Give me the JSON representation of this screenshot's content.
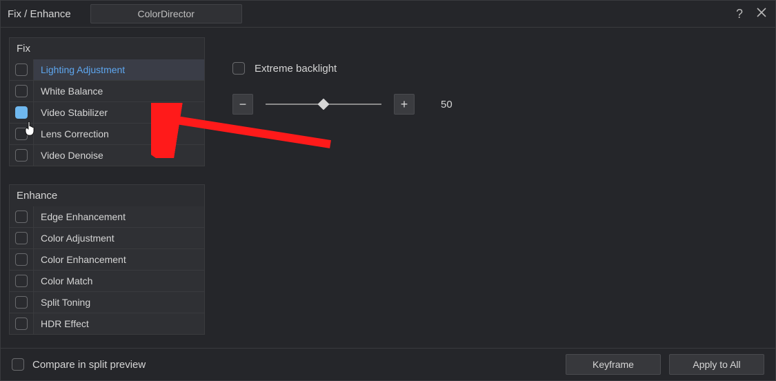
{
  "window": {
    "title": "Fix / Enhance",
    "top_button": "ColorDirector"
  },
  "sidebar": {
    "fix": {
      "header": "Fix",
      "items": [
        {
          "label": "Lighting Adjustment",
          "checked": false,
          "selected": true
        },
        {
          "label": "White Balance",
          "checked": false,
          "selected": false
        },
        {
          "label": "Video Stabilizer",
          "checked": true,
          "selected": false
        },
        {
          "label": "Lens Correction",
          "checked": false,
          "selected": false
        },
        {
          "label": "Video Denoise",
          "checked": false,
          "selected": false
        }
      ]
    },
    "enhance": {
      "header": "Enhance",
      "items": [
        {
          "label": "Edge Enhancement",
          "checked": false
        },
        {
          "label": "Color Adjustment",
          "checked": false
        },
        {
          "label": "Color Enhancement",
          "checked": false
        },
        {
          "label": "Color Match",
          "checked": false
        },
        {
          "label": "Split Toning",
          "checked": false
        },
        {
          "label": "HDR Effect",
          "checked": false
        }
      ]
    }
  },
  "content": {
    "extreme_backlight_label": "Extreme backlight",
    "extreme_backlight_checked": false,
    "slider_value": "50",
    "minus": "−",
    "plus": "+"
  },
  "footer": {
    "compare_label": "Compare in split preview",
    "compare_checked": false,
    "keyframe": "Keyframe",
    "apply_all": "Apply to All"
  }
}
